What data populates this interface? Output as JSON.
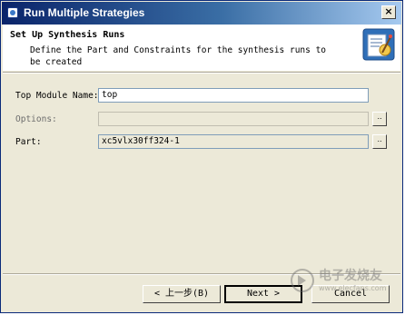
{
  "window": {
    "title": "Run Multiple Strategies",
    "close_label": "×"
  },
  "header": {
    "title": "Set Up Synthesis Runs",
    "description": "Define the Part and Constraints for the synthesis runs to be created"
  },
  "form": {
    "top_module": {
      "label": "Top Module Name:",
      "value": "top"
    },
    "options": {
      "label": "Options:",
      "value": "",
      "browse_label": ".."
    },
    "part": {
      "label": "Part:",
      "value": "xc5vlx30ff324-1",
      "browse_label": ".."
    }
  },
  "buttons": {
    "back": "< 上一步(B)",
    "next": "Next >",
    "cancel": "Cancel"
  },
  "watermark": {
    "text": "电子发烧友",
    "sub": "www.elecfans.com"
  }
}
